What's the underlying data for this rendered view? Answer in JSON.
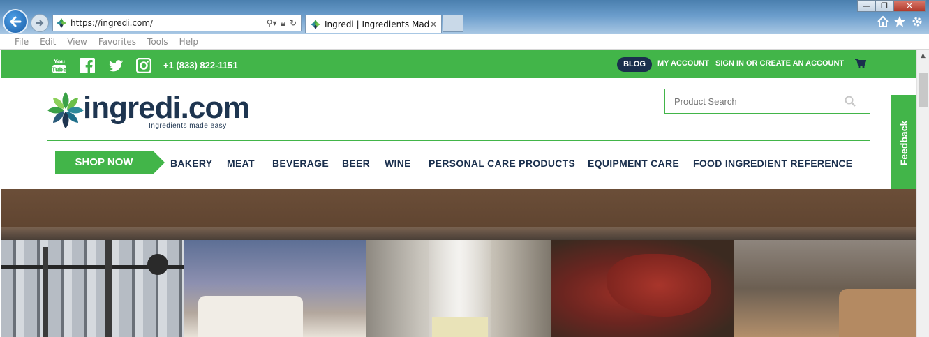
{
  "browser": {
    "url": "https://ingredi.com/",
    "tab_title": "Ingredi | Ingredients Made ...",
    "tab_close": "✕",
    "menu": [
      "File",
      "Edit",
      "View",
      "Favorites",
      "Tools",
      "Help"
    ],
    "window_controls": {
      "minimize": "—",
      "maximize": "❐",
      "close": "✕"
    }
  },
  "topbar": {
    "phone": "+1 (833) 822-1151",
    "blog": "BLOG",
    "my_account": "MY ACCOUNT",
    "sign_in": "SIGN IN OR CREATE AN ACCOUNT",
    "social": [
      "youtube-icon",
      "facebook-icon",
      "twitter-icon",
      "instagram-icon"
    ],
    "color": "#42b549"
  },
  "logo": {
    "text": "ingredi.com",
    "tagline": "Ingredients made easy"
  },
  "search": {
    "placeholder": "Product Search"
  },
  "nav": {
    "shop_now": "SHOP NOW",
    "items": [
      "BAKERY",
      "MEAT",
      "BEVERAGE",
      "BEER",
      "WINE",
      "PERSONAL CARE PRODUCTS",
      "EQUIPMENT CARE",
      "FOOD INGREDIENT REFERENCE"
    ]
  },
  "feedback": "Feedback",
  "colors": {
    "brand_green": "#42b549",
    "navy": "#1a2f4d"
  }
}
